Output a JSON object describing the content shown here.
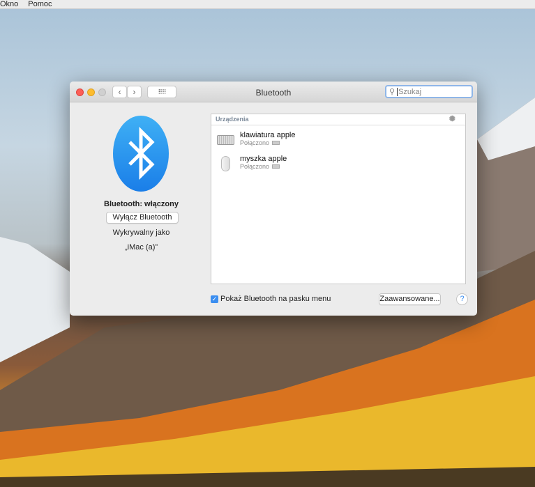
{
  "menubar": {
    "items": [
      "Okno",
      "Pomoc"
    ]
  },
  "window": {
    "title": "Bluetooth",
    "search_placeholder": "Szukaj"
  },
  "left": {
    "status": "Bluetooth: włączony",
    "toggle_button": "Wyłącz Bluetooth",
    "discoverable_label": "Wykrywalny jako",
    "device_name": "„iMac (a)”"
  },
  "devices": {
    "header": "Urządzenia",
    "items": [
      {
        "name": "klawiatura apple",
        "status": "Połączono",
        "icon": "keyboard-icon"
      },
      {
        "name": "myszka apple",
        "status": "Połączono",
        "icon": "mouse-icon"
      }
    ]
  },
  "footer": {
    "show_in_menu_label": "Pokaż Bluetooth na pasku menu",
    "show_in_menu_checked": true,
    "advanced_button": "Zaawansowane...",
    "help": "?"
  }
}
